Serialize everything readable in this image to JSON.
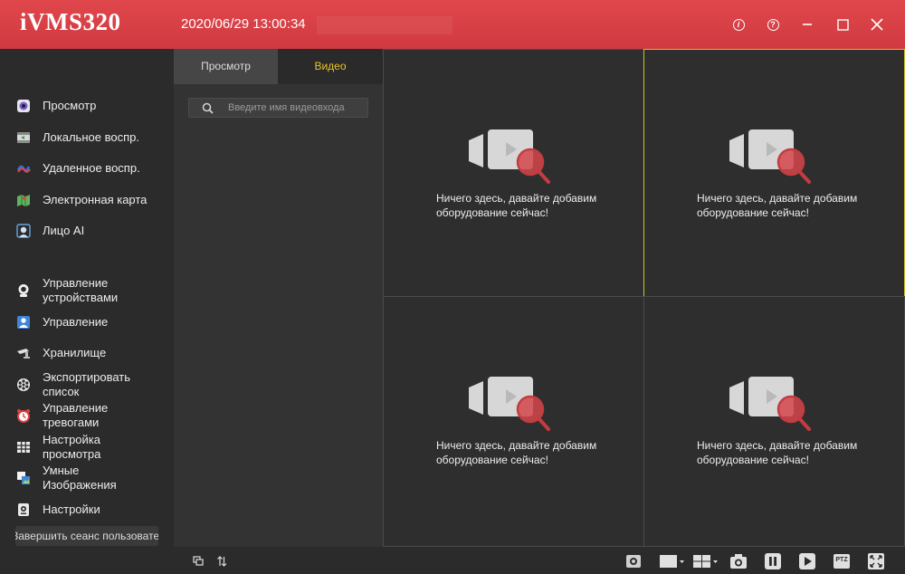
{
  "titlebar": {
    "app_name": "iVMS320",
    "datetime": "2020/06/29 13:00:34",
    "buttons": [
      "info-icon",
      "help-icon",
      "minimize-icon",
      "maximize-icon",
      "close-icon"
    ]
  },
  "sidebar": {
    "items": [
      {
        "label": "Просмотр",
        "icon": "preview-icon"
      },
      {
        "label": "Локальное воспр.",
        "icon": "local-playback-icon"
      },
      {
        "label": "Удаленное воспр.",
        "icon": "remote-playback-icon"
      },
      {
        "label": "Электронная карта",
        "icon": "emap-icon"
      },
      {
        "label": "Лицо AI",
        "icon": "face-ai-icon"
      },
      {
        "label": "Управление устройствами",
        "icon": "device-management-icon"
      },
      {
        "label": "Управление",
        "icon": "user-management-icon"
      },
      {
        "label": "Хранилище",
        "icon": "storage-icon"
      },
      {
        "label": "Экспортировать список",
        "icon": "export-list-icon"
      },
      {
        "label": "Управление тревогами",
        "icon": "alarm-icon"
      },
      {
        "label": "Настройка просмотра",
        "icon": "view-settings-icon"
      },
      {
        "label": "Умные Изображения",
        "icon": "smart-images-icon"
      },
      {
        "label": "Настройки",
        "icon": "settings-icon"
      }
    ],
    "logout_label": "Завершить сеанс пользователя"
  },
  "panel": {
    "tabs": [
      {
        "label": "Просмотр",
        "active": false
      },
      {
        "label": "Видео",
        "active": true
      }
    ],
    "search_placeholder": "Введите имя видеовхода",
    "footer_icons": [
      "windows-icon",
      "sort-icon"
    ]
  },
  "video_grid": {
    "layout": "2x2",
    "selected_cell": 2,
    "cells": [
      {
        "message": "Ничего здесь, давайте добавим оборудование сейчас!"
      },
      {
        "message": "Ничего здесь, давайте добавим оборудование сейчас!"
      },
      {
        "message": "Ничего здесь, давайте добавим оборудование сейчас!"
      },
      {
        "message": "Ничего здесь, давайте добавим оборудование сейчас!"
      }
    ]
  },
  "toolbar": {
    "buttons": [
      "record-icon",
      "single-window-icon",
      "quad-window-icon",
      "snapshot-icon",
      "pause-icon",
      "play-icon",
      "ptz-icon",
      "fullscreen-icon"
    ],
    "ptz_label": "PTZ"
  },
  "colors": {
    "titlebar": "#d93e44",
    "background": "#2b2b2b",
    "active_tab_text": "#e8c32c",
    "selected_cell_border": "#c9c228",
    "magnifier": "#d3474b"
  }
}
